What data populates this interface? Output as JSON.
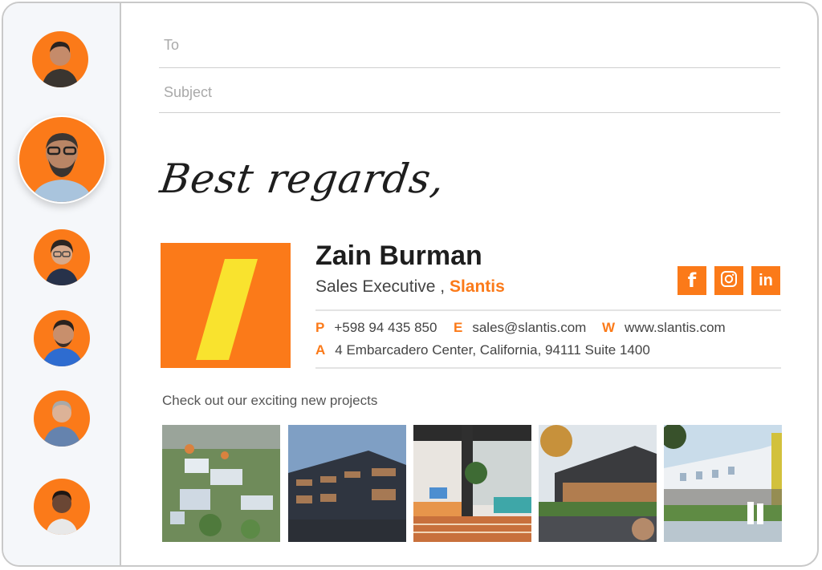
{
  "compose": {
    "to_placeholder": "To",
    "subject_placeholder": "Subject"
  },
  "sidebar": {
    "avatars": [
      {
        "label": "Contact avatar 1",
        "selected": false
      },
      {
        "label": "Contact avatar 2",
        "selected": true
      },
      {
        "label": "Contact avatar 3",
        "selected": false
      },
      {
        "label": "Contact avatar 4",
        "selected": false
      },
      {
        "label": "Contact avatar 5",
        "selected": false
      },
      {
        "label": "Contact avatar 6",
        "selected": false
      }
    ]
  },
  "signature": {
    "signoff": "Best regards,",
    "name": "Zain Burman",
    "job_title": "Sales Executive ,",
    "company": "Slantis",
    "social": [
      {
        "icon": "facebook-icon",
        "glyph": "f"
      },
      {
        "icon": "instagram-icon",
        "glyph": ""
      },
      {
        "icon": "linkedin-icon",
        "glyph": "in"
      }
    ],
    "contact": {
      "phone_key": "P",
      "phone": "+598 94 435 850",
      "email_key": "E",
      "email": "sales@slantis.com",
      "web_key": "W",
      "web": "www.slantis.com",
      "address_key": "A",
      "address": "4 Embarcadero Center, California, 94111 Suite 1400"
    },
    "promo_text": "Check out our exciting new projects",
    "projects": [
      {
        "label": "Aerial residential complex"
      },
      {
        "label": "Glass office building at dusk"
      },
      {
        "label": "Modern office interior"
      },
      {
        "label": "Commercial building with lawn"
      },
      {
        "label": "Campus building with pedestrians"
      }
    ]
  },
  "colors": {
    "accent": "#fb7a19",
    "logo_slash": "#f9e32e",
    "text_dark": "#1e1e1e"
  }
}
